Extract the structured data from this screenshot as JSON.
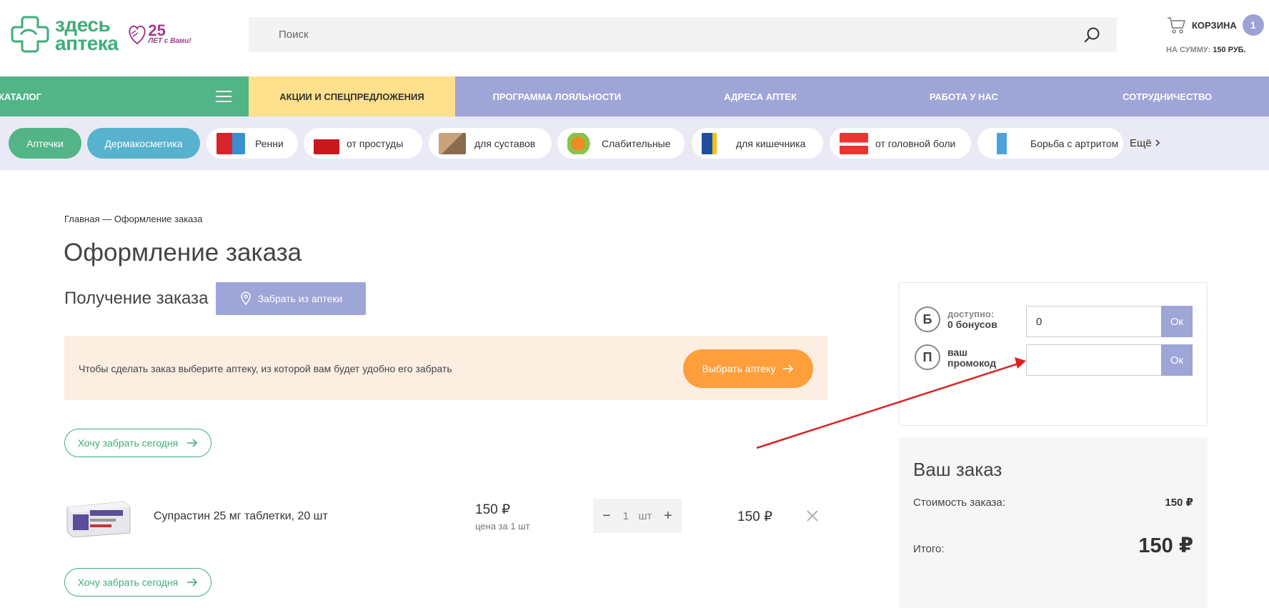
{
  "header": {
    "logo_text_line1": "здесь",
    "logo_text_line2": "аптека",
    "logo_anniversary_num": "25",
    "logo_anniversary_sub": "ЛЕТ с Вами!",
    "search_placeholder": "Поиск",
    "cart_label": "КОРЗИНА",
    "cart_count": "1",
    "cart_sum_label": "НА СУММУ:",
    "cart_sum_value": "150 РУБ."
  },
  "nav": {
    "catalog": "КАТАЛОГ",
    "promo": "АКЦИИ И СПЕЦПРЕДЛОЖЕНИЯ",
    "items": [
      "ПРОГРАММА ЛОЯЛЬНОСТИ",
      "АДРЕСА АПТЕК",
      "РАБОТА У НАС",
      "СОТРУДНИЧЕСТВО"
    ]
  },
  "chips": {
    "pharmacies": "Аптечки",
    "derma": "Дермакосметика",
    "items": [
      "Ренни",
      "от простуды",
      "для суставов",
      "Слабительные",
      "для кишечника",
      "от головной боли",
      "Борьба с артритом"
    ],
    "more": "Ещё"
  },
  "page": {
    "breadcrumb": "Главная — Оформление заказа",
    "title": "Оформление заказа",
    "receive_label": "Получение заказа",
    "pickup_button": "Забрать из аптеки",
    "notice_text": "Чтобы сделать заказ выберите аптеку, из которой вам будет удобно его забрать",
    "choose_pharmacy": "Выбрать аптеку",
    "today_button": "Хочу забрать сегодня"
  },
  "product": {
    "name": "Супрастин 25 мг таблетки, 20 шт",
    "price": "150 ₽",
    "price_sub": "цена за 1 шт",
    "qty": "1",
    "unit": "шт",
    "total": "150 ₽"
  },
  "bonus": {
    "bonus_letter": "Б",
    "available_label": "доступно:",
    "available_value": "0 бонусов",
    "bonus_input_value": "0",
    "ok": "Ок",
    "promo_letter": "П",
    "promo_label_1": "ваш",
    "promo_label_2": "промокод",
    "promo_input_value": ""
  },
  "order": {
    "title": "Ваш заказ",
    "cost_label": "Стоимость заказа:",
    "cost_value": "150 ₽",
    "total_label": "Итого:",
    "total_value": "150 ₽"
  },
  "colors": {
    "green": "#52b487",
    "purple": "#9ea5d7",
    "yellow": "#ffe08c",
    "orange": "#ff9f3c",
    "annotation_arrow": "#dd2222"
  }
}
